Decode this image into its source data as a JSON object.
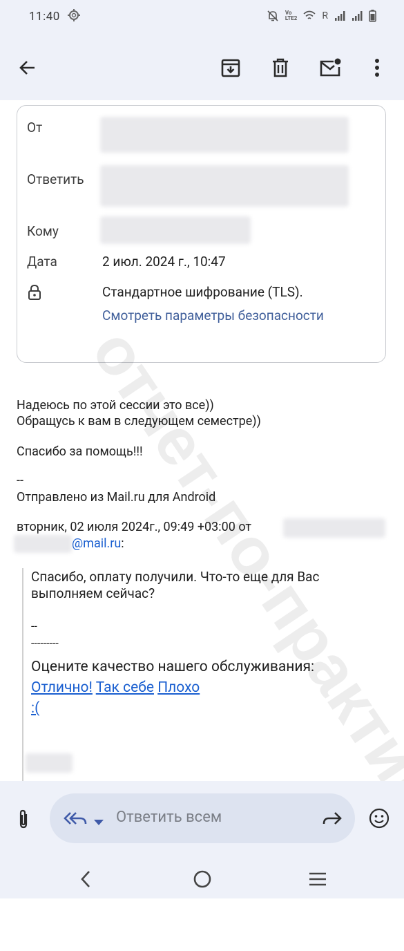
{
  "status_bar": {
    "time": "11:40",
    "icons": [
      "settings-icon",
      "mute-icon",
      "volte-icon",
      "wifi-icon",
      "roaming-indicator",
      "signal-icon",
      "signal-icon",
      "battery-icon"
    ],
    "roaming_label": "R"
  },
  "app_bar": {
    "icons": [
      "back-arrow-icon",
      "archive-icon",
      "delete-icon",
      "mark-unread-icon",
      "more-vert-icon"
    ]
  },
  "details": {
    "from_label": "От",
    "reply_to_label": "Ответить",
    "to_label": "Кому",
    "date_label": "Дата",
    "date_value": "2 июл. 2024 г., 10:47",
    "encryption_text": "Стандартное шифрование (TLS).",
    "security_link": "Смотреть параметры безопасности"
  },
  "body": {
    "line1": "Надеюсь по этой сессии это все))",
    "line2": "Обращусь к вам в следующем семестре))",
    "thanks": "Спасибо за помощь!!!",
    "sig_sep": "--",
    "sent_from": "Отправлено из Mail.ru для Android",
    "quote_header": "вторник, 02 июля 2024г., 09:49 +03:00 от",
    "quote_email_domain": "@mail.ru",
    "quote_email_suffix": ":"
  },
  "quote": {
    "line1": "Спасибо, оплату получили. Что-то еще для Вас",
    "line2": "выполняем сейчас?",
    "sep1": "--",
    "sep2": "---------",
    "rating_prompt": "Оцените качество нашего обслуживания:",
    "rating_excellent": "Отлично!",
    "rating_ok": "Так себе",
    "rating_bad": "Плохо",
    "rating_sad": ":("
  },
  "watermark": "отчет-по-практике.рф",
  "reply_bar": {
    "placeholder": "Ответить всем"
  },
  "nav_bar": {
    "icons": [
      "nav-back-icon",
      "nav-home-icon",
      "nav-recents-icon"
    ]
  },
  "colors": {
    "bar_bg": "#eef1f9",
    "link": "#1a5fd0",
    "security_link": "#3f5e9a",
    "pill": "#dde3f0"
  }
}
